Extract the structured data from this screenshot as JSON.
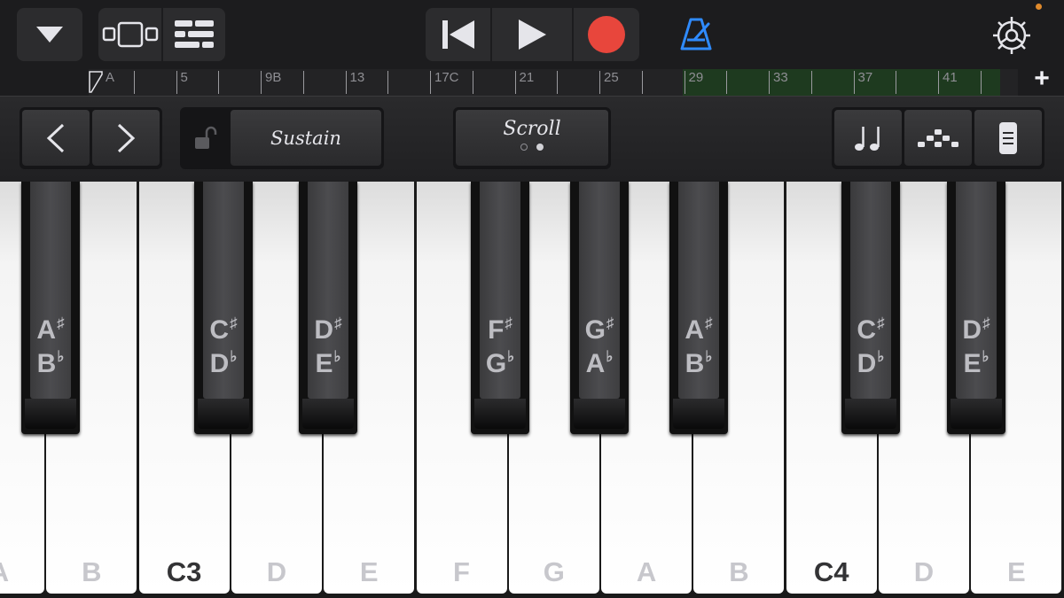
{
  "topbar": {
    "icons": [
      "chevron-down-icon",
      "browser-view-icon",
      "tracks-view-icon",
      "rewind-icon",
      "play-icon",
      "record-icon",
      "metronome-icon",
      "settings-gear-icon"
    ],
    "accent_colors": {
      "record": "#e8463c",
      "metronome": "#2f8bff"
    }
  },
  "ruler": {
    "bar_labels": [
      "A",
      "5",
      "9B",
      "13",
      "17C",
      "21",
      "25",
      "29",
      "33",
      "37",
      "41"
    ],
    "add_label": "+",
    "cycle_region_color": "#1e3a1f"
  },
  "controls": {
    "prev_label": "<",
    "next_label": ">",
    "sustain_label": "Sustain",
    "scroll_label": "Scroll",
    "right_icons": [
      "notes-icon",
      "arpeggiator-icon",
      "keyboard-layout-icon"
    ]
  },
  "keyboard": {
    "white_keys": [
      "A",
      "B",
      "C3",
      "D",
      "E",
      "F",
      "G",
      "A",
      "B",
      "C4",
      "D",
      "E"
    ],
    "black_keys": [
      {
        "top": "A",
        "top_acc": "#",
        "bottom": "B",
        "bottom_acc": "b"
      },
      {
        "top": "C",
        "top_acc": "#",
        "bottom": "D",
        "bottom_acc": "b"
      },
      {
        "top": "D",
        "top_acc": "#",
        "bottom": "E",
        "bottom_acc": "b"
      },
      {
        "top": "F",
        "top_acc": "#",
        "bottom": "G",
        "bottom_acc": "b"
      },
      {
        "top": "G",
        "top_acc": "#",
        "bottom": "A",
        "bottom_acc": "b"
      },
      {
        "top": "A",
        "top_acc": "#",
        "bottom": "B",
        "bottom_acc": "b"
      },
      {
        "top": "C",
        "top_acc": "#",
        "bottom": "D",
        "bottom_acc": "b"
      },
      {
        "top": "D",
        "top_acc": "#",
        "bottom": "E",
        "bottom_acc": "b"
      }
    ]
  }
}
